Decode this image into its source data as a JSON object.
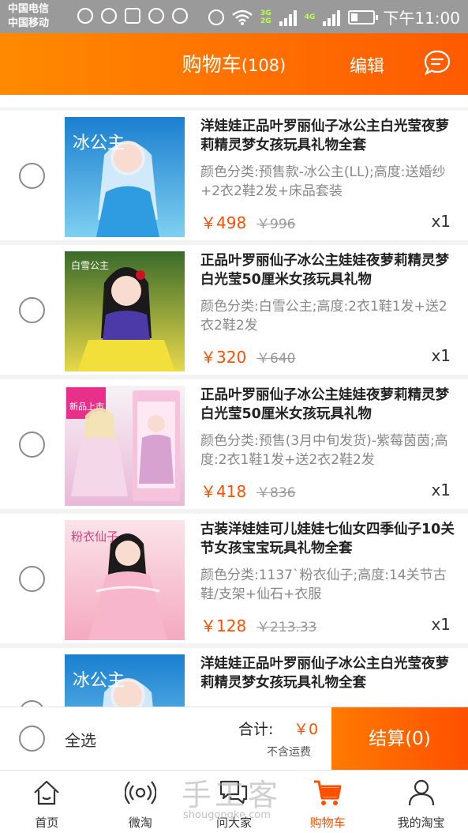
{
  "status_bar": {
    "carrier_1": "中国电信",
    "carrier_2": "中国移动",
    "net_3g": "3G",
    "net_2g": "2G",
    "net_4g": "4G",
    "battery_level": 0.3,
    "time": "下午11:00"
  },
  "header": {
    "title": "购物车",
    "count": "(108)",
    "edit_label": "编辑",
    "message_icon": "message-bubble-icon"
  },
  "items": [
    {
      "name": "洋娃娃正品叶罗丽仙子冰公主白光莹夜萝莉精灵梦女孩玩具礼物全套",
      "sku": "颜色分类:预售款-冰公主(LL);高度:送婚纱+2衣2鞋2发+床品套装",
      "price": "￥498",
      "old_price": "￥996",
      "qty": "x1",
      "thumb_colors": [
        "#1a7fd0",
        "#7fd0f0"
      ],
      "thumb_text": "冰公主"
    },
    {
      "name": "正品叶罗丽仙子冰公主娃娃夜萝莉精灵梦白光莹50厘米女孩玩具礼物",
      "sku": "颜色分类:白雪公主;高度:2衣1鞋1发+送2衣2鞋2发",
      "price": "￥320",
      "old_price": "￥640",
      "qty": "x1",
      "thumb_colors": [
        "#3a6b2a",
        "#e8d84a"
      ],
      "thumb_text": "白雪公主"
    },
    {
      "name": "正品叶罗丽仙子冰公主娃娃夜萝莉精灵梦白光莹50厘米女孩玩具礼物",
      "sku": "颜色分类:预售(3月中旬发货)-紫莓茵茵;高度:2衣1鞋1发+送2衣2鞋2发",
      "price": "￥418",
      "old_price": "￥836",
      "qty": "x1",
      "thumb_colors": [
        "#f6f2f4",
        "#e9b8d8"
      ],
      "thumb_text": "新品上市"
    },
    {
      "name": "古装洋娃娃可儿娃娃七仙女四季仙子10关节女孩宝宝玩具礼物全套",
      "sku": "颜色分类:1137`粉衣仙子;高度:14关节古鞋/支架+仙石+衣服",
      "price": "￥128",
      "old_price": "￥213.33",
      "qty": "x1",
      "thumb_colors": [
        "#fbe3ea",
        "#f4a9c0"
      ],
      "thumb_text": "粉衣仙子"
    },
    {
      "name": "洋娃娃正品叶罗丽仙子冰公主白光莹夜萝莉精灵梦女孩玩具礼物全套",
      "sku": "",
      "price": "",
      "old_price": "",
      "qty": "",
      "thumb_colors": [
        "#1a7fd0",
        "#7fd0f0"
      ],
      "thumb_text": "冰公主"
    }
  ],
  "checkout": {
    "select_all": "全选",
    "total_label": "合计:",
    "total_amount": "￥0",
    "shipping_note": "不含运费",
    "pay_button": "结算(0)"
  },
  "tabs": [
    {
      "label": "首页",
      "icon": "home-icon",
      "active": false
    },
    {
      "label": "微淘",
      "icon": "broadcast-icon",
      "active": false
    },
    {
      "label": "问大家",
      "icon": "chat-bubbles-icon",
      "active": false
    },
    {
      "label": "购物车",
      "icon": "cart-icon",
      "active": true
    },
    {
      "label": "我的淘宝",
      "icon": "user-icon",
      "active": false
    }
  ],
  "watermark": {
    "text": "手工客",
    "url": "shougongke.com"
  },
  "colors": {
    "accent": "#ff5000",
    "header_start": "#ff8a00",
    "header_end": "#ff5a00"
  }
}
